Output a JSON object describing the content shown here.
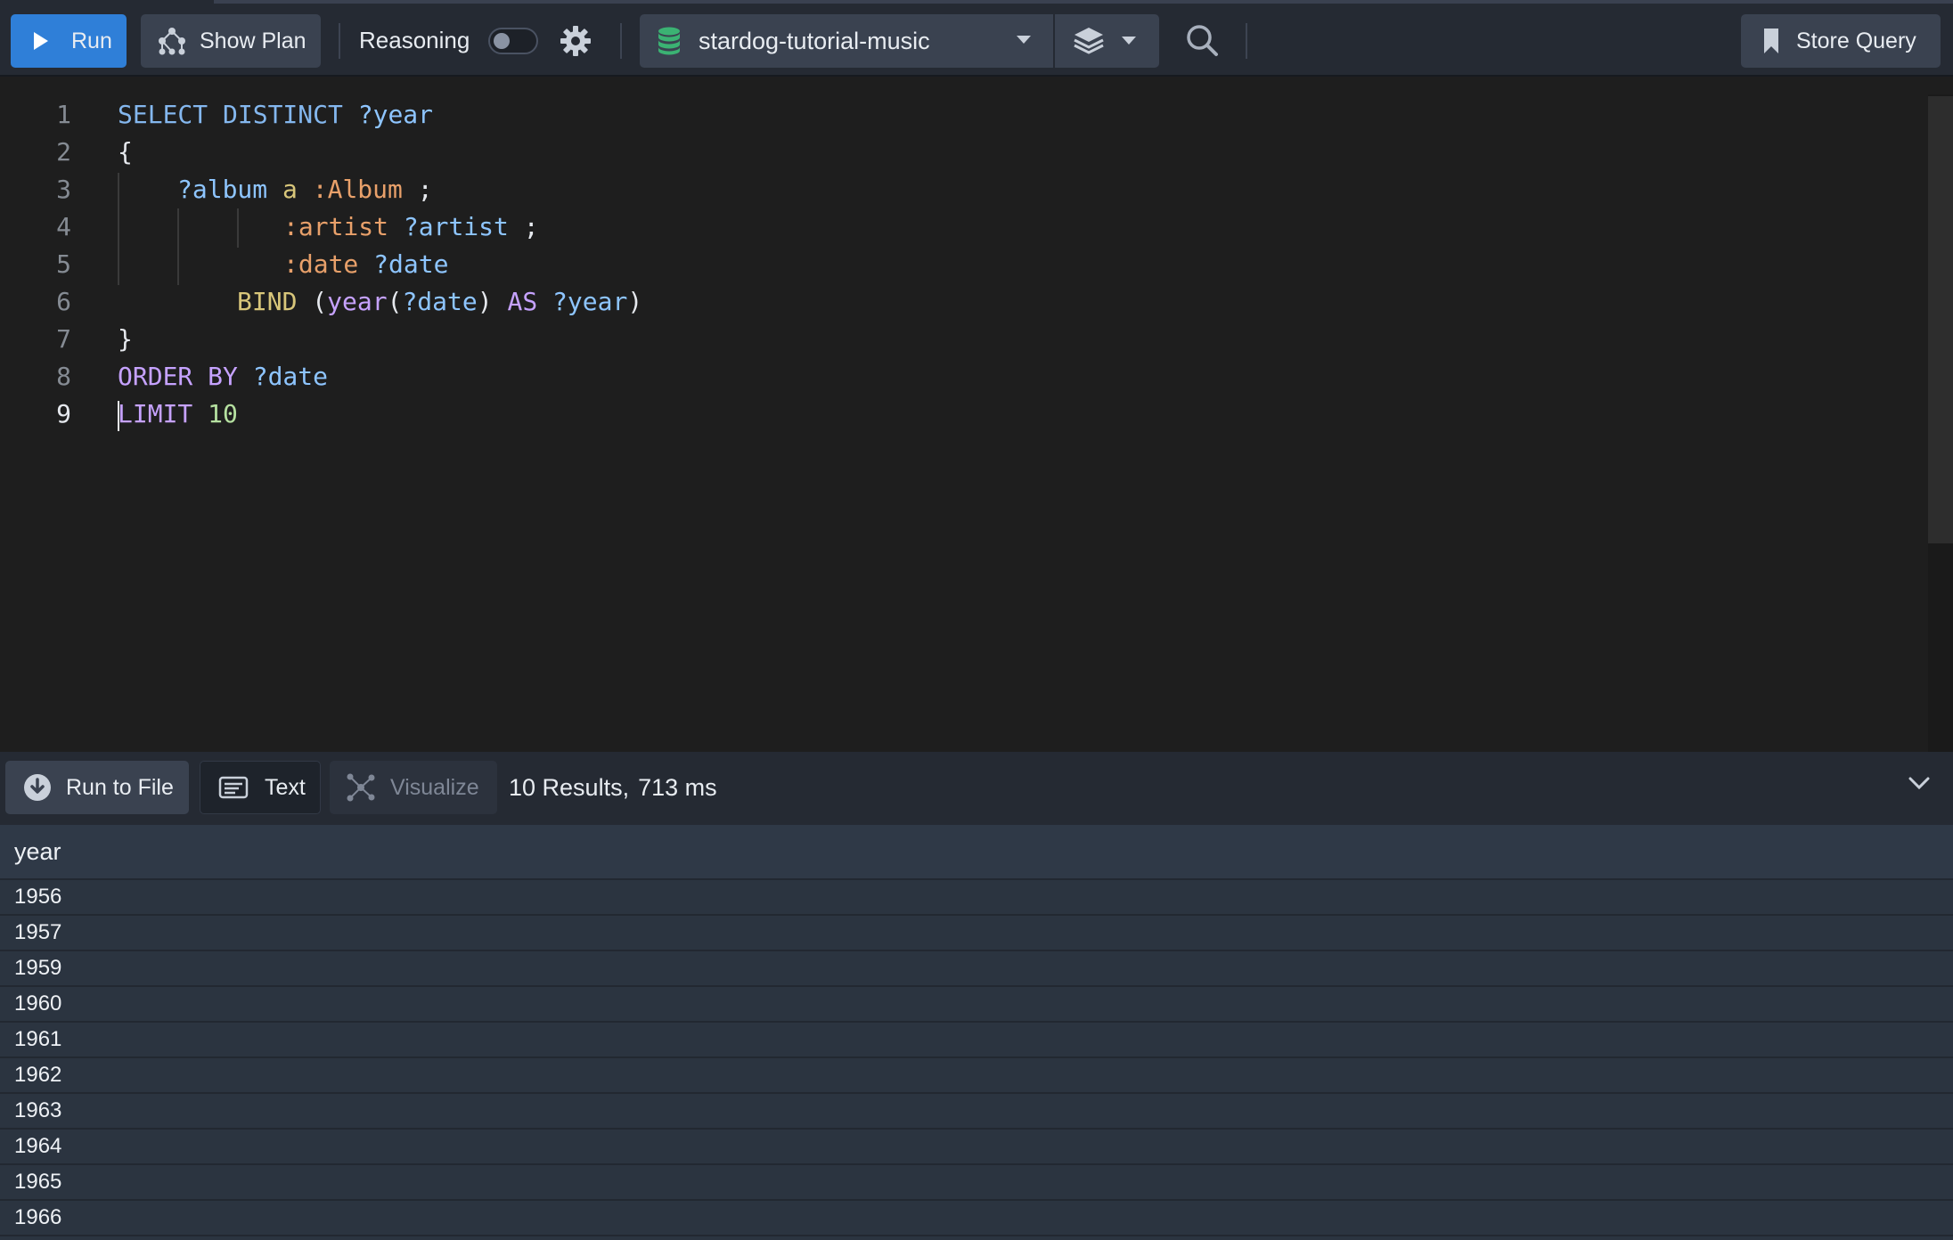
{
  "toolbar": {
    "run_label": "Run",
    "show_plan_label": "Show Plan",
    "reasoning_label": "Reasoning",
    "reasoning_enabled": false,
    "database": "stardog-tutorial-music",
    "store_query_label": "Store Query"
  },
  "editor": {
    "active_line": 9,
    "lines": [
      {
        "n": "1"
      },
      {
        "n": "2"
      },
      {
        "n": "3"
      },
      {
        "n": "4"
      },
      {
        "n": "5"
      },
      {
        "n": "6"
      },
      {
        "n": "7"
      },
      {
        "n": "8"
      },
      {
        "n": "9"
      }
    ],
    "tokens": {
      "l1_select": "SELECT DISTINCT",
      "l1_var": "?year",
      "l2": "{",
      "l3_var": "?album",
      "l3_a": "a",
      "l3_class": ":Album",
      "l3_semi": ";",
      "l4_pred": ":artist",
      "l4_var": "?artist",
      "l4_semi": ";",
      "l5_pred": ":date",
      "l5_var": "?date",
      "l6_bind": "BIND",
      "l6_open": "(",
      "l6_fn": "year",
      "l6_paren": "(",
      "l6_var": "?date",
      "l6_close": ")",
      "l6_as": "AS",
      "l6_var2": "?year",
      "l6_close2": ")",
      "l7": "}",
      "l8_kw": "ORDER BY",
      "l8_var": "?date",
      "l9_kw": "LIMIT",
      "l9_num": "10"
    }
  },
  "results": {
    "run_to_file_label": "Run to File",
    "text_label": "Text",
    "visualize_label": "Visualize",
    "count_text": "10 Results,",
    "time_text": "713 ms",
    "column": "year",
    "rows": [
      "1956",
      "1957",
      "1959",
      "1960",
      "1961",
      "1962",
      "1963",
      "1964",
      "1965",
      "1966"
    ]
  }
}
